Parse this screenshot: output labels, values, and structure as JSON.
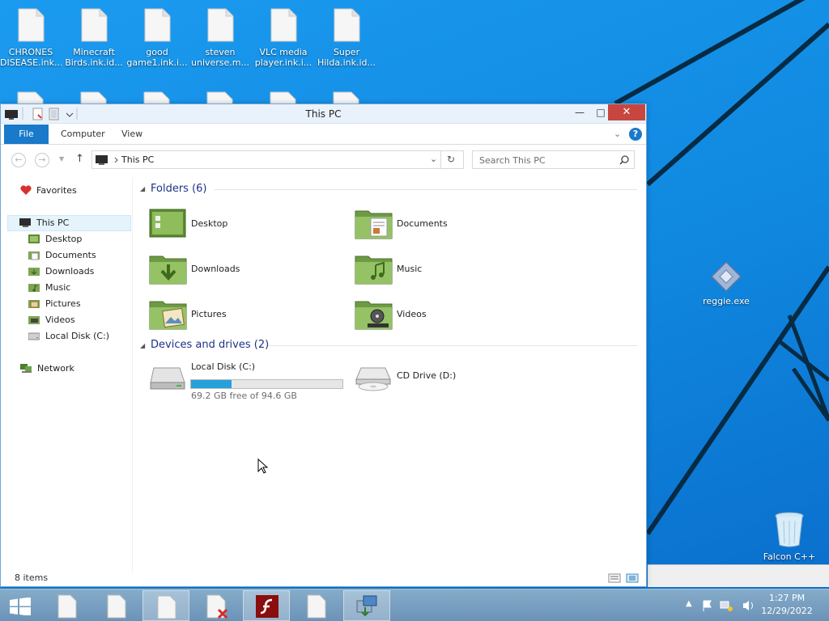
{
  "desktop": {
    "icons_top": [
      {
        "line1": "CHRONES",
        "line2": "DISEASE.ink..."
      },
      {
        "line1": "Minecraft",
        "line2": "Birds.ink.id..."
      },
      {
        "line1": "good",
        "line2": "game1.ink.i..."
      },
      {
        "line1": "steven",
        "line2": "universe.m..."
      },
      {
        "line1": "VLC media",
        "line2": "player.ink.i..."
      },
      {
        "line1": "Super",
        "line2": "Hilda.ink.id..."
      }
    ],
    "reggie": "reggie.exe",
    "trash": "Falcon C++"
  },
  "window": {
    "title": "This PC",
    "tabs": {
      "file": "File",
      "computer": "Computer",
      "view": "View"
    },
    "address": "This PC",
    "search_placeholder": "Search This PC",
    "status": "8 items"
  },
  "navpane": {
    "favorites": "Favorites",
    "this_pc": "This PC",
    "children": [
      "Desktop",
      "Documents",
      "Downloads",
      "Music",
      "Pictures",
      "Videos",
      "Local Disk (C:)"
    ],
    "network": "Network"
  },
  "content": {
    "folders_header": "Folders (6)",
    "folders": [
      "Desktop",
      "Documents",
      "Downloads",
      "Music",
      "Pictures",
      "Videos"
    ],
    "devices_header": "Devices and drives (2)",
    "local_disk": {
      "name": "Local Disk (C:)",
      "free_text": "69.2 GB free of 94.6 GB",
      "used_fraction": 0.27
    },
    "cd_drive": "CD Drive (D:)"
  },
  "taskbar": {
    "time": "1:27 PM",
    "date": "12/29/2022"
  },
  "colors": {
    "accent": "#1979ca",
    "close": "#c7463f",
    "drive_fill": "#26a0da",
    "header_text": "#1e3287"
  }
}
